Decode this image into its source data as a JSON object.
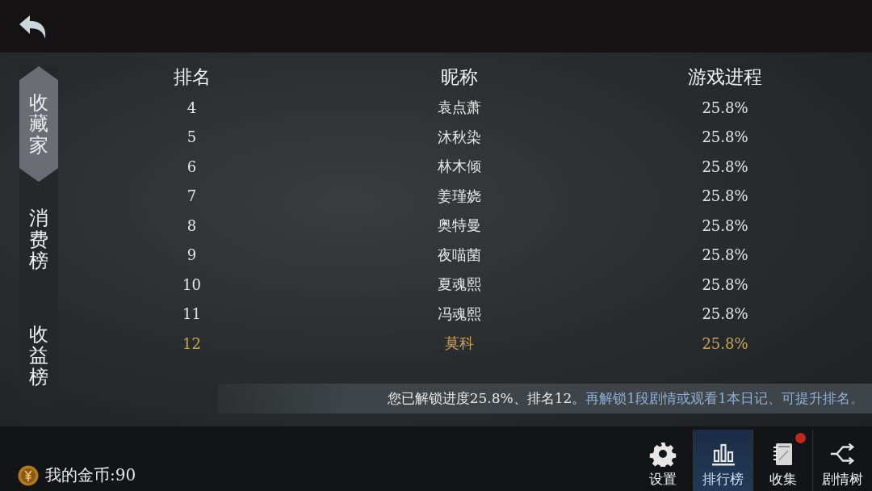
{
  "sidebar": {
    "tabs": [
      {
        "label": "收藏家",
        "selected": true
      },
      {
        "label": "消费榜",
        "selected": false
      },
      {
        "label": "收益榜",
        "selected": false
      }
    ]
  },
  "table": {
    "columns": [
      "排名",
      "昵称",
      "游戏进程"
    ],
    "rows": [
      {
        "cells": [
          "4",
          "袁点萧",
          "25.8%"
        ],
        "highlighted": false
      },
      {
        "cells": [
          "5",
          "沐秋染",
          "25.8%"
        ],
        "highlighted": false
      },
      {
        "cells": [
          "6",
          "林木倾",
          "25.8%"
        ],
        "highlighted": false
      },
      {
        "cells": [
          "7",
          "姜瑾娆",
          "25.8%"
        ],
        "highlighted": false
      },
      {
        "cells": [
          "8",
          "奥特曼",
          "25.8%"
        ],
        "highlighted": false
      },
      {
        "cells": [
          "9",
          "夜喵菌",
          "25.8%"
        ],
        "highlighted": false
      },
      {
        "cells": [
          "10",
          "夏魂熙",
          "25.8%"
        ],
        "highlighted": false
      },
      {
        "cells": [
          "11",
          "冯魂熙",
          "25.8%"
        ],
        "highlighted": false
      },
      {
        "cells": [
          "12",
          "莫科",
          "25.8%"
        ],
        "highlighted": true
      }
    ]
  },
  "notice": {
    "text": "您已解锁进度25.8%、排名12。",
    "hint": "再解锁1段剧情或观看1本日记、可提升排名。"
  },
  "coins": {
    "label": "我的金币:90"
  },
  "nav": [
    {
      "kind": "settings",
      "label": "设置",
      "selected": false,
      "badge": false
    },
    {
      "kind": "ranking",
      "label": "排行榜",
      "selected": true,
      "badge": false
    },
    {
      "kind": "collection",
      "label": "收集",
      "selected": false,
      "badge": true
    },
    {
      "kind": "storytree",
      "label": "剧情树",
      "selected": false,
      "badge": false
    }
  ]
}
